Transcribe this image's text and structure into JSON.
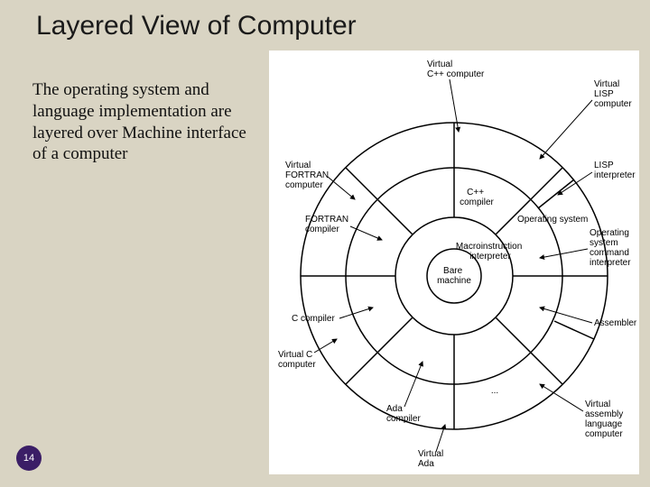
{
  "slide": {
    "title": "Layered View of Computer",
    "body": "The operating system and language implementation are layered over Machine interface of a computer",
    "page_number": "14"
  },
  "diagram": {
    "center_label": "Bare\nmachine",
    "inner_ring": [
      "Macroinstruction\ninterpreter"
    ],
    "middle_ring": [
      "C++\ncompiler",
      "Operating system",
      "Operating\nsystem\ncommand\ninterpreter",
      "Assembler",
      "...",
      "Ada\ncompiler",
      "C compiler",
      "FORTRAN\ncompiler"
    ],
    "outer_ring": [
      "Virtual C++\ncomputer",
      "Virtual LISP\ncomputer",
      "LISP\ninterpreter",
      "—",
      "Virtual assembly\nlanguage computer",
      "Virtual Ada\ncomputer",
      "Virtual C\ncomputer",
      "Virtual FORTRAN\ncomputer"
    ],
    "external_labels": {
      "top": "Virtual\nC++ computer",
      "top_right": "Virtual\nLISP\ncomputer",
      "right": "LISP\ninterpreter",
      "right_mid": "Operating\nsystem\ncommand\ninterpreter",
      "right_low": "Assembler",
      "bottom_right": "Virtual\nassembly\nlanguage\ncomputer",
      "bottom": "Virtual\nAda\ncomputer",
      "bottom_left": "Ada\ncompiler",
      "left_low": "C compiler",
      "left": "Virtual C\ncomputer",
      "left_mid": "FORTRAN\ncompiler",
      "top_left": "Virtual\nFORTRAN\ncomputer"
    },
    "ring_labels_inside": {
      "cpp_compiler": "C++\ncompiler",
      "os": "Operating system",
      "macro": "Macroinstruction\ninterpreter"
    }
  }
}
